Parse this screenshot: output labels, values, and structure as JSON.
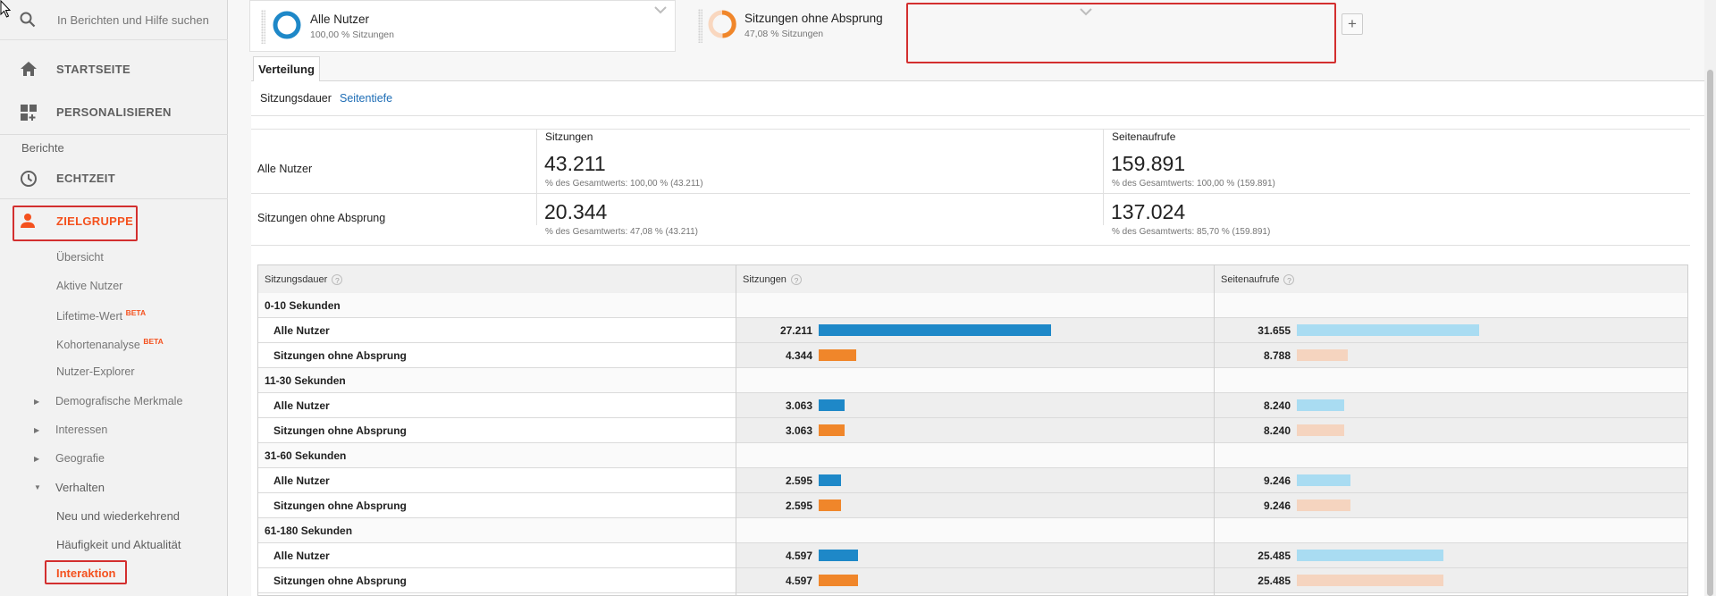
{
  "sidebar": {
    "search_placeholder": "In Berichten und Hilfe suchen",
    "home_label": "STARTSEITE",
    "customize_label": "PERSONALISIEREN",
    "reports_heading": "Berichte",
    "realtime_label": "ECHTZEIT",
    "audience_label": "ZIELGRUPPE",
    "audience_items": [
      {
        "label": "Übersicht"
      },
      {
        "label": "Aktive Nutzer"
      },
      {
        "label": "Lifetime-Wert",
        "badge": "BETA"
      },
      {
        "label": "Kohortenanalyse",
        "badge": "BETA"
      },
      {
        "label": "Nutzer-Explorer"
      }
    ],
    "expandables": [
      {
        "label": "Demografische Merkmale"
      },
      {
        "label": "Interessen"
      },
      {
        "label": "Geografie"
      },
      {
        "label": "Verhalten"
      }
    ],
    "behavior_items": [
      {
        "label": "Neu und wiederkehrend"
      },
      {
        "label": "Häufigkeit und Aktualität"
      },
      {
        "label": "Interaktion"
      }
    ],
    "accent_color": "#f4511e"
  },
  "segments": [
    {
      "name": "Alle Nutzer",
      "share": "100,00 % Sitzungen",
      "ring_color": "#1e88c8"
    },
    {
      "name": "Sitzungen ohne Absprung",
      "share": "47,08 % Sitzungen",
      "ring_color": "#f0862a"
    }
  ],
  "add_segment_label": "+",
  "tab_label": "Verteilung",
  "subtabs": {
    "active": "Sitzungsdauer",
    "link": "Seitentiefe"
  },
  "summary": {
    "headers": {
      "sessions": "Sitzungen",
      "pageviews": "Seitenaufrufe"
    },
    "rows": [
      {
        "label": "Alle Nutzer",
        "sessions": "43.211",
        "sessions_sub": "% des Gesamtwerts: 100,00 % (43.211)",
        "pageviews": "159.891",
        "pageviews_sub": "% des Gesamtwerts: 100,00 % (159.891)"
      },
      {
        "label": "Sitzungen ohne Absprung",
        "sessions": "20.344",
        "sessions_sub": "% des Gesamtwerts: 47,08 % (43.211)",
        "pageviews": "137.024",
        "pageviews_sub": "% des Gesamtwerts: 85,70 % (159.891)"
      }
    ]
  },
  "table": {
    "headers": {
      "dimension": "Sitzungsdauer",
      "sessions": "Sitzungen",
      "pageviews": "Seitenaufrufe"
    },
    "help_icon": "?",
    "colors": {
      "sessions_all": "#1e88c8",
      "sessions_nb": "#f0862a",
      "pageviews_all": "#a9dcf2",
      "pageviews_nb": "#f5d4bf"
    },
    "groups": [
      {
        "label": "0-10 Sekunden",
        "rows": [
          {
            "label": "Alle Nutzer",
            "sessions": "27.211",
            "sessions_value": 27211,
            "pageviews": "31.655",
            "pageviews_value": 31655
          },
          {
            "label": "Sitzungen ohne Absprung",
            "sessions": "4.344",
            "sessions_value": 4344,
            "pageviews": "8.788",
            "pageviews_value": 8788
          }
        ]
      },
      {
        "label": "11-30 Sekunden",
        "rows": [
          {
            "label": "Alle Nutzer",
            "sessions": "3.063",
            "sessions_value": 3063,
            "pageviews": "8.240",
            "pageviews_value": 8240
          },
          {
            "label": "Sitzungen ohne Absprung",
            "sessions": "3.063",
            "sessions_value": 3063,
            "pageviews": "8.240",
            "pageviews_value": 8240
          }
        ]
      },
      {
        "label": "31-60 Sekunden",
        "rows": [
          {
            "label": "Alle Nutzer",
            "sessions": "2.595",
            "sessions_value": 2595,
            "pageviews": "9.246",
            "pageviews_value": 9246
          },
          {
            "label": "Sitzungen ohne Absprung",
            "sessions": "2.595",
            "sessions_value": 2595,
            "pageviews": "9.246",
            "pageviews_value": 9246
          }
        ]
      },
      {
        "label": "61-180 Sekunden",
        "rows": [
          {
            "label": "Alle Nutzer",
            "sessions": "4.597",
            "sessions_value": 4597,
            "pageviews": "25.485",
            "pageviews_value": 25485
          },
          {
            "label": "Sitzungen ohne Absprung",
            "sessions": "4.597",
            "sessions_value": 4597,
            "pageviews": "25.485",
            "pageviews_value": 25485
          }
        ]
      }
    ]
  }
}
